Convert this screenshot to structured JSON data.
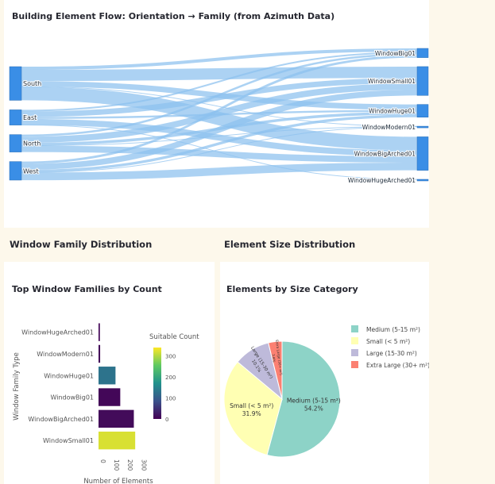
{
  "toolbar": {
    "icons": [
      "camera-icon",
      "plotly-logo-icon",
      "fullscreen-icon"
    ]
  },
  "sankey": {
    "title": "Building Element Flow: Orientation → Family (from Azimuth Data)",
    "sources": [
      "South",
      "East",
      "North",
      "West"
    ],
    "targets": [
      "WindowBig01",
      "WindowSmall01",
      "WindowHuge01",
      "WindowModern01",
      "WindowBigArched01",
      "WindowHugeArched01"
    ],
    "source_totals": [
      245,
      111,
      127,
      135
    ],
    "target_totals": [
      67,
      210,
      93,
      4,
      244,
      0
    ],
    "flows": [
      {
        "source": "South",
        "target": "WindowBig01",
        "value": 23
      },
      {
        "source": "South",
        "target": "WindowSmall01",
        "value": 82
      },
      {
        "source": "South",
        "target": "WindowHuge01",
        "value": 40
      },
      {
        "source": "South",
        "target": "WindowModern01",
        "value": 2
      },
      {
        "source": "South",
        "target": "WindowBigArched01",
        "value": 98
      },
      {
        "source": "East",
        "target": "WindowBig01",
        "value": 12
      },
      {
        "source": "East",
        "target": "WindowSmall01",
        "value": 40
      },
      {
        "source": "East",
        "target": "WindowHuge01",
        "value": 14
      },
      {
        "source": "East",
        "target": "WindowBigArched01",
        "value": 44
      },
      {
        "source": "East",
        "target": "WindowHugeArched01",
        "value": 1
      },
      {
        "source": "North",
        "target": "WindowBig01",
        "value": 15
      },
      {
        "source": "North",
        "target": "WindowSmall01",
        "value": 45
      },
      {
        "source": "North",
        "target": "WindowHuge01",
        "value": 20
      },
      {
        "source": "North",
        "target": "WindowModern01",
        "value": 1
      },
      {
        "source": "North",
        "target": "WindowBigArched01",
        "value": 46
      },
      {
        "source": "West",
        "target": "WindowBig01",
        "value": 17
      },
      {
        "source": "West",
        "target": "WindowSmall01",
        "value": 43
      },
      {
        "source": "West",
        "target": "WindowHuge01",
        "value": 19
      },
      {
        "source": "West",
        "target": "WindowModern01",
        "value": 1
      },
      {
        "source": "West",
        "target": "WindowBigArched01",
        "value": 56
      }
    ],
    "colors": {
      "node": "#3a8ee6",
      "link": "#8cc0ee"
    }
  },
  "sections": {
    "family_title": "Window Family Distribution",
    "size_title": "Element Size Distribution"
  },
  "chart_data": [
    {
      "type": "bar",
      "orientation": "horizontal",
      "title": "Top Window Families by Count",
      "categories": [
        "WindowHugeArched01",
        "WindowModern01",
        "WindowHuge01",
        "WindowBig01",
        "WindowBigArched01",
        "WindowSmall01"
      ],
      "values": [
        10,
        12,
        125,
        160,
        260,
        270
      ],
      "xlabel": "Number of Elements",
      "ylabel": "Window Family Type",
      "xticks": [
        0,
        100,
        200,
        300
      ],
      "xlim": [
        0,
        310
      ],
      "colorscale": "viridis",
      "colorbar": {
        "title": "Suitable Count",
        "ticks": [
          0,
          100,
          200,
          300
        ],
        "range": [
          0,
          340
        ]
      },
      "color_values": [
        5,
        8,
        130,
        6,
        10,
        320
      ]
    },
    {
      "type": "pie",
      "title": "Elements by Size Category",
      "labels": [
        "Medium (5-15 m²)",
        "Small (< 5 m²)",
        "Large (15-30 m²)",
        "Extra Large (30+ m²)"
      ],
      "values": [
        54.2,
        31.9,
        10.1,
        3.8
      ],
      "slice_labels": [
        "Medium (5-15 m²)",
        "Small (< 5 m²)",
        "Large (15-30 m²)",
        "Extra Large (30+ m²)"
      ],
      "percent_labels": [
        "54.2%",
        "31.9%",
        "10.1%",
        "3.8%"
      ],
      "colors": [
        "#8dd3c7",
        "#ffffb3",
        "#bebada",
        "#fb8072"
      ],
      "legend": "right"
    }
  ]
}
